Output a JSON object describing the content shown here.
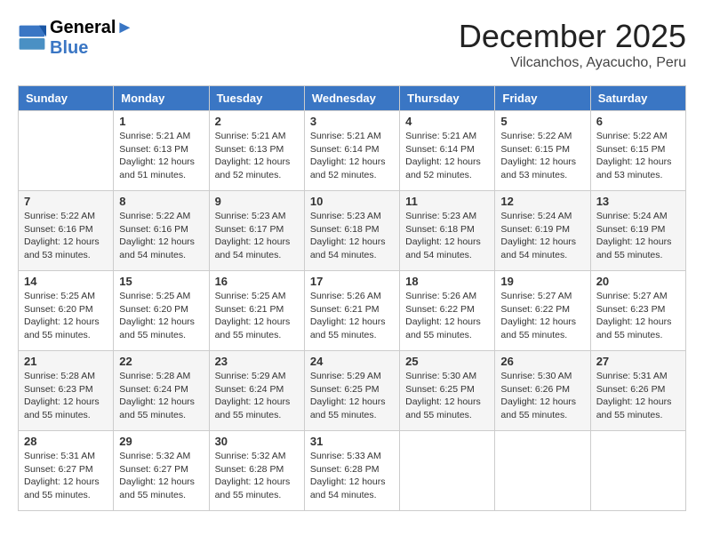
{
  "logo": {
    "line1": "General",
    "line2": "Blue"
  },
  "title": "December 2025",
  "subtitle": "Vilcanchos, Ayacucho, Peru",
  "days_header": [
    "Sunday",
    "Monday",
    "Tuesday",
    "Wednesday",
    "Thursday",
    "Friday",
    "Saturday"
  ],
  "weeks": [
    [
      {
        "day": "",
        "sunrise": "",
        "sunset": "",
        "daylight": ""
      },
      {
        "day": "1",
        "sunrise": "Sunrise: 5:21 AM",
        "sunset": "Sunset: 6:13 PM",
        "daylight": "Daylight: 12 hours and 51 minutes."
      },
      {
        "day": "2",
        "sunrise": "Sunrise: 5:21 AM",
        "sunset": "Sunset: 6:13 PM",
        "daylight": "Daylight: 12 hours and 52 minutes."
      },
      {
        "day": "3",
        "sunrise": "Sunrise: 5:21 AM",
        "sunset": "Sunset: 6:14 PM",
        "daylight": "Daylight: 12 hours and 52 minutes."
      },
      {
        "day": "4",
        "sunrise": "Sunrise: 5:21 AM",
        "sunset": "Sunset: 6:14 PM",
        "daylight": "Daylight: 12 hours and 52 minutes."
      },
      {
        "day": "5",
        "sunrise": "Sunrise: 5:22 AM",
        "sunset": "Sunset: 6:15 PM",
        "daylight": "Daylight: 12 hours and 53 minutes."
      },
      {
        "day": "6",
        "sunrise": "Sunrise: 5:22 AM",
        "sunset": "Sunset: 6:15 PM",
        "daylight": "Daylight: 12 hours and 53 minutes."
      }
    ],
    [
      {
        "day": "7",
        "sunrise": "Sunrise: 5:22 AM",
        "sunset": "Sunset: 6:16 PM",
        "daylight": "Daylight: 12 hours and 53 minutes."
      },
      {
        "day": "8",
        "sunrise": "Sunrise: 5:22 AM",
        "sunset": "Sunset: 6:16 PM",
        "daylight": "Daylight: 12 hours and 54 minutes."
      },
      {
        "day": "9",
        "sunrise": "Sunrise: 5:23 AM",
        "sunset": "Sunset: 6:17 PM",
        "daylight": "Daylight: 12 hours and 54 minutes."
      },
      {
        "day": "10",
        "sunrise": "Sunrise: 5:23 AM",
        "sunset": "Sunset: 6:18 PM",
        "daylight": "Daylight: 12 hours and 54 minutes."
      },
      {
        "day": "11",
        "sunrise": "Sunrise: 5:23 AM",
        "sunset": "Sunset: 6:18 PM",
        "daylight": "Daylight: 12 hours and 54 minutes."
      },
      {
        "day": "12",
        "sunrise": "Sunrise: 5:24 AM",
        "sunset": "Sunset: 6:19 PM",
        "daylight": "Daylight: 12 hours and 54 minutes."
      },
      {
        "day": "13",
        "sunrise": "Sunrise: 5:24 AM",
        "sunset": "Sunset: 6:19 PM",
        "daylight": "Daylight: 12 hours and 55 minutes."
      }
    ],
    [
      {
        "day": "14",
        "sunrise": "Sunrise: 5:25 AM",
        "sunset": "Sunset: 6:20 PM",
        "daylight": "Daylight: 12 hours and 55 minutes."
      },
      {
        "day": "15",
        "sunrise": "Sunrise: 5:25 AM",
        "sunset": "Sunset: 6:20 PM",
        "daylight": "Daylight: 12 hours and 55 minutes."
      },
      {
        "day": "16",
        "sunrise": "Sunrise: 5:25 AM",
        "sunset": "Sunset: 6:21 PM",
        "daylight": "Daylight: 12 hours and 55 minutes."
      },
      {
        "day": "17",
        "sunrise": "Sunrise: 5:26 AM",
        "sunset": "Sunset: 6:21 PM",
        "daylight": "Daylight: 12 hours and 55 minutes."
      },
      {
        "day": "18",
        "sunrise": "Sunrise: 5:26 AM",
        "sunset": "Sunset: 6:22 PM",
        "daylight": "Daylight: 12 hours and 55 minutes."
      },
      {
        "day": "19",
        "sunrise": "Sunrise: 5:27 AM",
        "sunset": "Sunset: 6:22 PM",
        "daylight": "Daylight: 12 hours and 55 minutes."
      },
      {
        "day": "20",
        "sunrise": "Sunrise: 5:27 AM",
        "sunset": "Sunset: 6:23 PM",
        "daylight": "Daylight: 12 hours and 55 minutes."
      }
    ],
    [
      {
        "day": "21",
        "sunrise": "Sunrise: 5:28 AM",
        "sunset": "Sunset: 6:23 PM",
        "daylight": "Daylight: 12 hours and 55 minutes."
      },
      {
        "day": "22",
        "sunrise": "Sunrise: 5:28 AM",
        "sunset": "Sunset: 6:24 PM",
        "daylight": "Daylight: 12 hours and 55 minutes."
      },
      {
        "day": "23",
        "sunrise": "Sunrise: 5:29 AM",
        "sunset": "Sunset: 6:24 PM",
        "daylight": "Daylight: 12 hours and 55 minutes."
      },
      {
        "day": "24",
        "sunrise": "Sunrise: 5:29 AM",
        "sunset": "Sunset: 6:25 PM",
        "daylight": "Daylight: 12 hours and 55 minutes."
      },
      {
        "day": "25",
        "sunrise": "Sunrise: 5:30 AM",
        "sunset": "Sunset: 6:25 PM",
        "daylight": "Daylight: 12 hours and 55 minutes."
      },
      {
        "day": "26",
        "sunrise": "Sunrise: 5:30 AM",
        "sunset": "Sunset: 6:26 PM",
        "daylight": "Daylight: 12 hours and 55 minutes."
      },
      {
        "day": "27",
        "sunrise": "Sunrise: 5:31 AM",
        "sunset": "Sunset: 6:26 PM",
        "daylight": "Daylight: 12 hours and 55 minutes."
      }
    ],
    [
      {
        "day": "28",
        "sunrise": "Sunrise: 5:31 AM",
        "sunset": "Sunset: 6:27 PM",
        "daylight": "Daylight: 12 hours and 55 minutes."
      },
      {
        "day": "29",
        "sunrise": "Sunrise: 5:32 AM",
        "sunset": "Sunset: 6:27 PM",
        "daylight": "Daylight: 12 hours and 55 minutes."
      },
      {
        "day": "30",
        "sunrise": "Sunrise: 5:32 AM",
        "sunset": "Sunset: 6:28 PM",
        "daylight": "Daylight: 12 hours and 55 minutes."
      },
      {
        "day": "31",
        "sunrise": "Sunrise: 5:33 AM",
        "sunset": "Sunset: 6:28 PM",
        "daylight": "Daylight: 12 hours and 54 minutes."
      },
      {
        "day": "",
        "sunrise": "",
        "sunset": "",
        "daylight": ""
      },
      {
        "day": "",
        "sunrise": "",
        "sunset": "",
        "daylight": ""
      },
      {
        "day": "",
        "sunrise": "",
        "sunset": "",
        "daylight": ""
      }
    ]
  ]
}
